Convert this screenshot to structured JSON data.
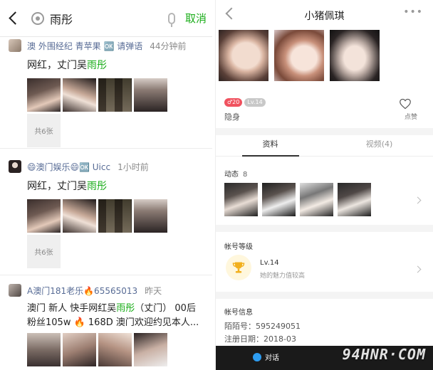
{
  "search": {
    "query": "雨彤",
    "cancel_label": "取消"
  },
  "posts": [
    {
      "author": "澳 外围经纪 青苹果 🆗 请弹语",
      "time": "44分钟前",
      "text_before": "网红，丈门吴",
      "text_highlight": "雨彤",
      "text_after": "",
      "more_label": "共6张"
    },
    {
      "author": "😄澳门娱乐😄🆗 Uicc",
      "time": "1小时前",
      "text_before": "网红，丈门吴",
      "text_highlight": "雨彤",
      "text_after": "",
      "more_label": "共6张"
    },
    {
      "author": "A澳门181老乐🔥65565013",
      "time": "昨天",
      "text_before": "澳门 新人 快手网红吴",
      "text_highlight": "雨彤",
      "text_after": "（丈门） 00后",
      "text_line2": "粉丝105w 🔥 168D 澳门欢迎约见本人..."
    }
  ],
  "profile": {
    "name": "小猪佩琪",
    "more": "•••",
    "badges": [
      "♂20",
      "Lv.14"
    ],
    "status": "隐身",
    "like_label": "点赞",
    "tabs": [
      "资料",
      "视频(4)"
    ],
    "dynamics_label": "动态",
    "dynamics_count": "8",
    "level_section": "帐号等级",
    "level": "Lv.14",
    "level_desc": "她的魅力值较高",
    "info_section": "帐号信息",
    "momo_id": "陌陌号：595249051",
    "register_date": "注册日期：2018-03",
    "chat_label": "对话"
  },
  "watermark": "94HNR·COM",
  "colors": {
    "wechat_green": "#1aad19",
    "link_blue": "#576b95",
    "badge_red": "#f0525f"
  }
}
